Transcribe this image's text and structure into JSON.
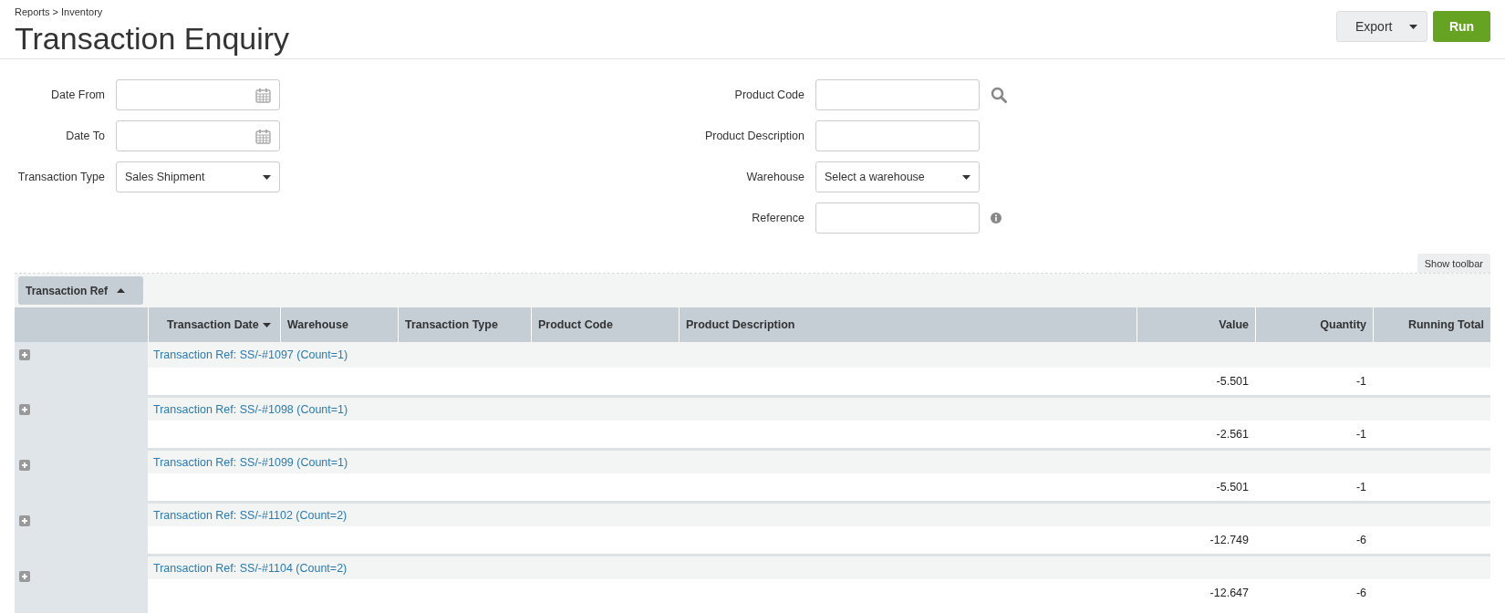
{
  "breadcrumb": "Reports > Inventory",
  "title": "Transaction Enquiry",
  "actions": {
    "export": "Export",
    "run": "Run"
  },
  "filters_left": [
    {
      "label": "Date From",
      "kind": "date"
    },
    {
      "label": "Date To",
      "kind": "date"
    },
    {
      "label": "Transaction Type",
      "kind": "select",
      "value": "Sales Shipment"
    }
  ],
  "filters_right": [
    {
      "label": "Product Code",
      "kind": "search"
    },
    {
      "label": "Product Description",
      "kind": "text"
    },
    {
      "label": "Warehouse",
      "kind": "select",
      "value": "Select a warehouse"
    },
    {
      "label": "Reference",
      "kind": "info"
    }
  ],
  "show_toolbar": "Show toolbar",
  "grouping": {
    "label": "Transaction Ref",
    "descending": false
  },
  "columns": [
    {
      "label": "Transaction Date",
      "numeric": false,
      "sorted": true,
      "descending": true
    },
    {
      "label": "Warehouse",
      "numeric": false,
      "sorted": false
    },
    {
      "label": "Transaction Type",
      "numeric": false,
      "sorted": false
    },
    {
      "label": "Product Code",
      "numeric": false,
      "sorted": false
    },
    {
      "label": "Product Description",
      "numeric": false,
      "sorted": false
    },
    {
      "label": "Value",
      "numeric": true,
      "sorted": false
    },
    {
      "label": "Quantity",
      "numeric": true,
      "sorted": false
    },
    {
      "label": "Running Total",
      "numeric": true,
      "sorted": false
    }
  ],
  "groups": [
    {
      "title": "Transaction Ref: SS/-#1097 (Count=1)",
      "expanded": false,
      "value": "-5.501",
      "quantity": "-1"
    },
    {
      "title": "Transaction Ref: SS/-#1098 (Count=1)",
      "expanded": false,
      "value": "-2.561",
      "quantity": "-1"
    },
    {
      "title": "Transaction Ref: SS/-#1099 (Count=1)",
      "expanded": false,
      "value": "-5.501",
      "quantity": "-1"
    },
    {
      "title": "Transaction Ref: SS/-#1102 (Count=2)",
      "expanded": false,
      "value": "-12.749",
      "quantity": "-6"
    },
    {
      "title": "Transaction Ref: SS/-#1104 (Count=2)",
      "expanded": false,
      "value": "-12.647",
      "quantity": "-6"
    }
  ]
}
